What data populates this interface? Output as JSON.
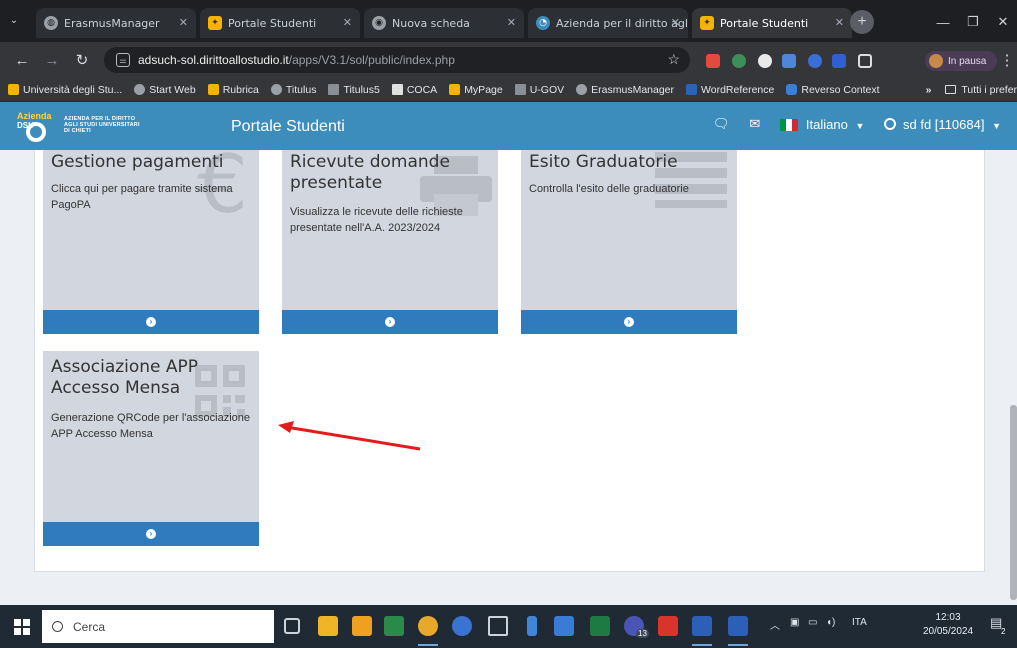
{
  "browser": {
    "tabs": [
      {
        "label": "ErasmusManager",
        "icon": "globe-icon"
      },
      {
        "label": "Portale Studenti",
        "icon": "students-icon"
      },
      {
        "label": "Nuova scheda",
        "icon": "chrome-icon"
      },
      {
        "label": "Azienda per il diritto agli...",
        "icon": "dsu-icon"
      },
      {
        "label": "Portale Studenti",
        "icon": "students-icon"
      }
    ],
    "url_host": "adsuch-sol.dirittoallostudio.it",
    "url_path": "/apps/V3.1/sol/public/index.php",
    "profile_status": "In pausa",
    "bookmarks": [
      "Università degli Stu...",
      "Start Web",
      "Rubrica",
      "Titulus",
      "Titulus5",
      "COCA",
      "MyPage",
      "U-GOV",
      "ErasmusManager",
      "WordReference",
      "Reverso Context"
    ],
    "bookmarks_overflow": "»",
    "all_bookmarks": "Tutti i preferiti"
  },
  "site": {
    "logo_text_line1": "AZIENDA PER IL DIRITTO",
    "logo_text_line2": "AGLI STUDI UNIVERSITARI",
    "logo_text_line3": "DI CHIETI",
    "logo_mark_top": "Azienda",
    "logo_mark_bottom": "DSU",
    "title": "Portale Studenti",
    "language": "Italiano",
    "user": "sd fd [110684]",
    "accent": "#3c8dbc"
  },
  "tiles": [
    {
      "title": "Gestione pagamenti",
      "desc": "Clicca qui per pagare tramite sistema PagoPA",
      "icon": "euro-icon"
    },
    {
      "title": "Ricevute domande presentate",
      "desc": "Visualizza le ricevute delle richieste presentate nell'A.A. 2023/2024",
      "icon": "printer-icon"
    },
    {
      "title": "Esito Graduatorie",
      "desc": "Controlla l'esito delle graduatorie",
      "icon": "list-icon"
    },
    {
      "title": "Associazione APP Accesso Mensa",
      "desc": "Generazione QRCode per l'associazione APP Accesso Mensa",
      "icon": "qrcode-icon"
    }
  ],
  "taskbar": {
    "search_placeholder": "Cerca",
    "teams_badge": "13",
    "language": "ITA",
    "time": "12:03",
    "date": "20/05/2024",
    "notifications": "2"
  },
  "annotation_color": "#e31b1b"
}
